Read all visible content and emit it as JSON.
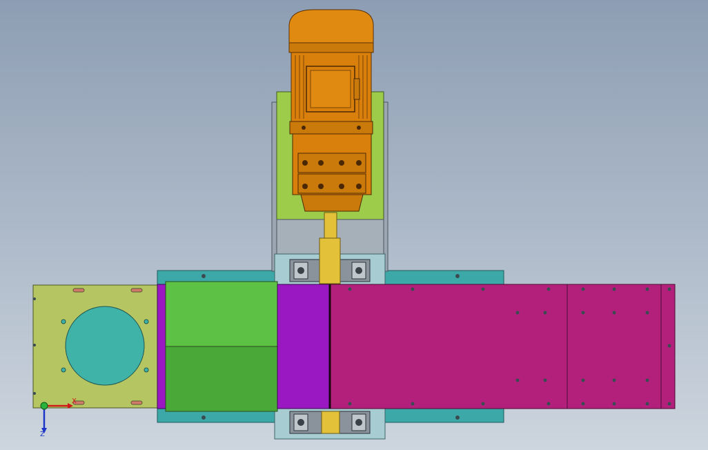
{
  "triad": {
    "x_label": "X",
    "z_label": "Z"
  },
  "colors": {
    "motor_orange": "#e08a12",
    "motor_dark": "#7a4406",
    "motor_shell": "#d87f0c",
    "flange_plate": "#b5c562",
    "inlet_circle": "#3fb3a8",
    "left_box_green": "#5cc144",
    "left_box_dark_green": "#4aa838",
    "violet_section": "#9a18c2",
    "magenta_housing": "#b2207c",
    "teal_rail": "#3ca9a8",
    "pale_blue_block": "#a7cdd2",
    "grey_bracket": "#9ba6b2",
    "shaft_yellow": "#e3c23a",
    "motor_mount_green": "#9dcc4a"
  }
}
